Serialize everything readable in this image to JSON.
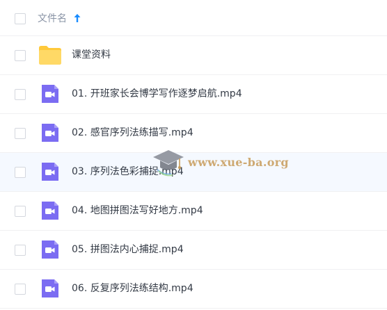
{
  "header": {
    "column_label": "文件名",
    "sort_icon": "arrow-up-icon",
    "sort_color": "#1a8cff"
  },
  "files": [
    {
      "name": "课堂资料",
      "icon": "folder-icon",
      "type": "folder"
    },
    {
      "name": "01. 开班家长会博学写作逐梦启航.mp4",
      "icon": "video-file-icon",
      "type": "video"
    },
    {
      "name": "02. 感官序列法练描写.mp4",
      "icon": "video-file-icon",
      "type": "video"
    },
    {
      "name": "03. 序列法色彩捕捉.mp4",
      "icon": "video-file-icon",
      "type": "video"
    },
    {
      "name": "04. 地图拼图法写好地方.mp4",
      "icon": "video-file-icon",
      "type": "video"
    },
    {
      "name": "05. 拼图法内心捕捉.mp4",
      "icon": "video-file-icon",
      "type": "video"
    },
    {
      "name": "06. 反复序列法练结构.mp4",
      "icon": "video-file-icon",
      "type": "video"
    }
  ],
  "watermark": {
    "text": "www.xue-ba.org",
    "icon": "graduation-cap-icon"
  },
  "colors": {
    "folder": "#ffd04d",
    "video": "#7b6cf2",
    "hover_row": "#f5f9ff",
    "watermark": "#c89c5a"
  }
}
